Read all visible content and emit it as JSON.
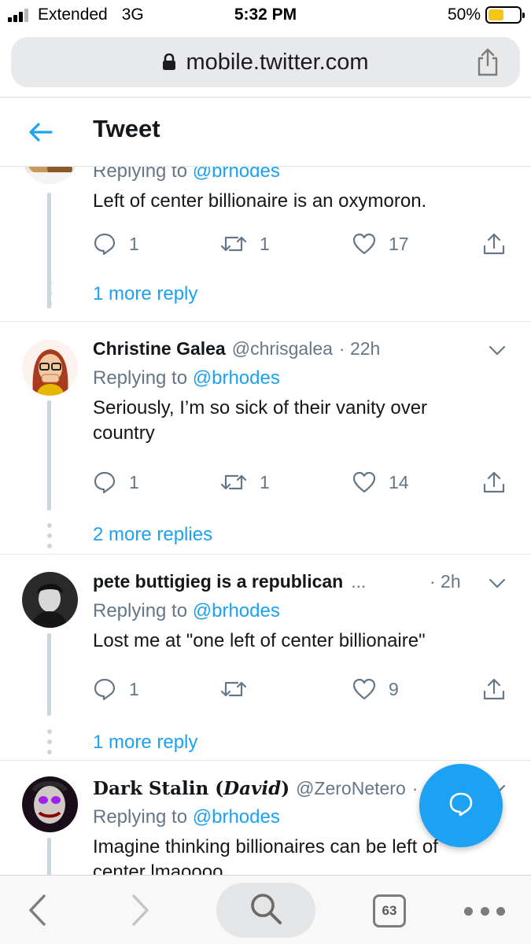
{
  "status_bar": {
    "carrier": "Extended",
    "network": "3G",
    "time": "5:32 PM",
    "battery_percent": "50%",
    "battery_level": 0.5,
    "battery_color": "#f5c518"
  },
  "browser": {
    "url": "mobile.twitter.com",
    "tab_count": "63",
    "icons": [
      "lock-icon",
      "share-icon",
      "back-arrow-icon",
      "forward-arrow-icon",
      "search-icon",
      "tabs-icon",
      "more-icon"
    ]
  },
  "header": {
    "title": "Tweet",
    "back_icon": "back-arrow-icon"
  },
  "colors": {
    "accent": "#1da1f2",
    "secondary_text": "#657786",
    "thread_line": "#ccd6dd"
  },
  "replies": [
    {
      "name": "",
      "handle": "",
      "time": "",
      "replying_prefix": "Replying to",
      "replying_to": "@brhodes",
      "text": "Left of center billionaire is an oxymoron.",
      "reply_count": "1",
      "retweet_count": "1",
      "like_count": "17",
      "more_replies": "1 more reply"
    },
    {
      "name": "Christine Galea",
      "handle": "@chrisgalea",
      "time": "· 22h",
      "replying_prefix": "Replying to",
      "replying_to": "@brhodes",
      "text": "Seriously, I’m so sick of their vanity over country",
      "reply_count": "1",
      "retweet_count": "1",
      "like_count": "14",
      "more_replies": "2 more replies"
    },
    {
      "name": "pete buttigieg is a republican",
      "name_ellipsis": "...",
      "handle": "",
      "time": "· 2h",
      "replying_prefix": "Replying to",
      "replying_to": "@brhodes",
      "text": "Lost me at \"one left of center billionaire\"",
      "reply_count": "1",
      "retweet_count": "",
      "like_count": "9",
      "more_replies": "1 more reply"
    },
    {
      "name_prefix": "Dark Stalin (",
      "name_emph": "David",
      "name_suffix": ")",
      "handle": "@ZeroNetero",
      "time": "·",
      "replying_prefix": "Replying to",
      "replying_to": "@brhodes",
      "text": "Imagine thinking billionaires can be left of center lmaoooo"
    }
  ],
  "fab": {
    "icon": "compose-reply-icon"
  }
}
